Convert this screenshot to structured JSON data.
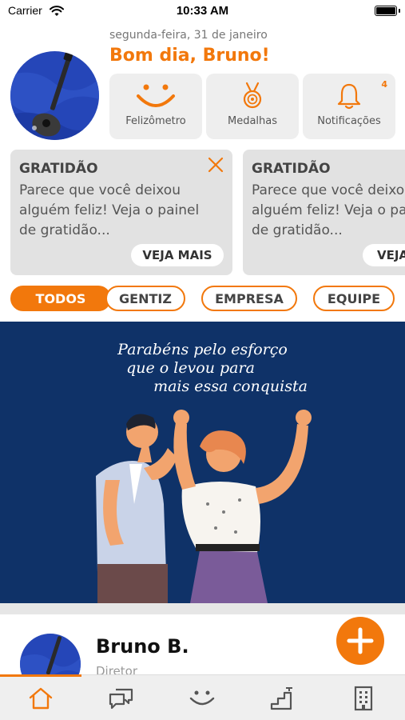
{
  "status": {
    "carrier": "Carrier",
    "time": "10:33 AM"
  },
  "header": {
    "date": "segunda-feira, 31 de janeiro",
    "greeting": "Bom dia, Bruno!"
  },
  "quick_actions": [
    {
      "label": "Felizômetro",
      "icon": "smile-icon"
    },
    {
      "label": "Medalhas",
      "icon": "medal-icon"
    },
    {
      "label": "Notificações",
      "icon": "bell-icon",
      "badge": "4"
    }
  ],
  "gratitude_cards": [
    {
      "title": "GRATIDÃO",
      "line1": "Parece que você deixou",
      "line2": "alguém feliz! Veja o painel",
      "line3": "de gratidão...",
      "button": "VEJA MAIS"
    },
    {
      "title": "GRATIDÃO",
      "line1": "Parece que você deixou",
      "line2": "alguém feliz! Veja o painel",
      "line3": "de gratidão...",
      "button": "VEJA MAIS"
    }
  ],
  "filters": {
    "items": [
      "TODOS",
      "GENTIZ",
      "EMPRESA",
      "EQUIPE"
    ],
    "active": "TODOS"
  },
  "banner": {
    "line1": "Parabéns pelo esforço",
    "line2": "que o levou para",
    "line3": "mais essa conquista"
  },
  "post": {
    "name": "Bruno B.",
    "role": "Diretor"
  },
  "tabbar": {
    "items": [
      "home-icon",
      "chat-icon",
      "smile-icon",
      "ranking-icon",
      "building-icon"
    ],
    "active": "home-icon"
  },
  "colors": {
    "accent": "#F2780C",
    "banner_bg": "#0F3268",
    "card_bg": "#eeeeee"
  }
}
